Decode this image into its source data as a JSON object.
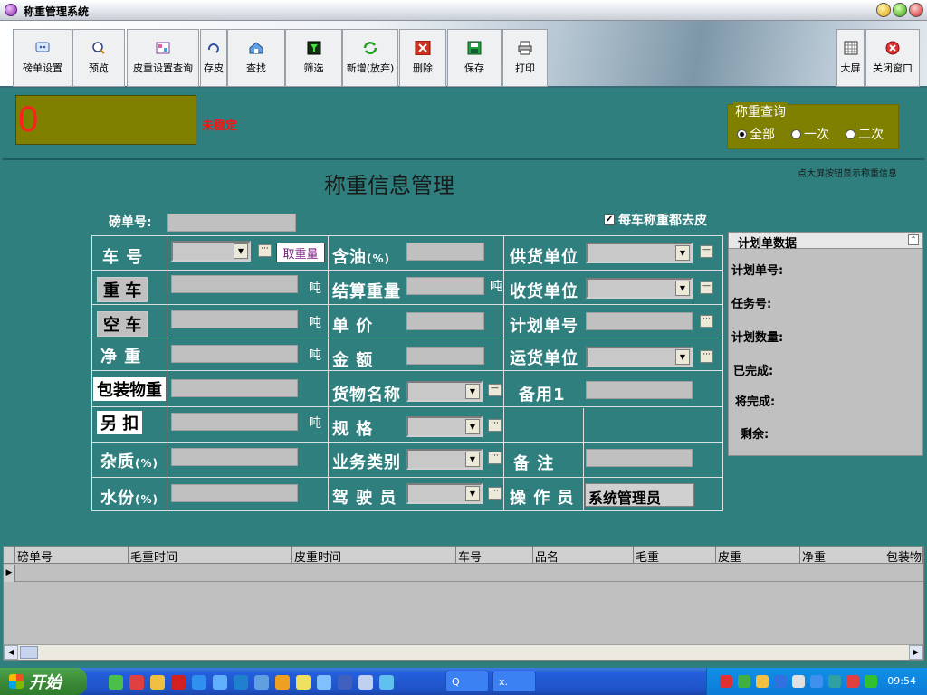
{
  "window": {
    "title": "称重管理系统"
  },
  "toolbar": {
    "items": [
      {
        "label": "磅单设置"
      },
      {
        "label": "预览"
      },
      {
        "label": "皮重设置查询"
      },
      {
        "label": "存皮"
      },
      {
        "label": "查找"
      },
      {
        "label": "筛选"
      },
      {
        "label": "新增(放弃)"
      },
      {
        "label": "删除"
      },
      {
        "label": "保存"
      },
      {
        "label": "打印"
      }
    ],
    "right": [
      {
        "label": "大屏"
      },
      {
        "label": "关闭窗口"
      }
    ]
  },
  "status": {
    "weight": "0",
    "stability": "未稳定",
    "query": {
      "legend": "称重查询",
      "options": [
        "全部",
        "一次",
        "二次"
      ],
      "selected": "全部"
    }
  },
  "form": {
    "title": "称重信息管理",
    "hint": "点大屏按钮显示称重信息",
    "bd_label": "磅单号:",
    "tare_checkbox": "每车称重都去皮",
    "tare_checked": true,
    "take_weight": "取重量",
    "unit": "吨",
    "percent": "(%)",
    "col1": {
      "plate": "车  号",
      "heavy": "重 车",
      "empty": "空 车",
      "net": "净  重",
      "package": "包装物重",
      "deduct": "另 扣",
      "impurity": "杂质",
      "moisture": "水份"
    },
    "col2": {
      "oil": "含油",
      "settle": "结算重量",
      "price": "单   价",
      "amount": "金   额",
      "goods": "货物名称",
      "spec": "规   格",
      "biz": "业务类别",
      "driver": "驾 驶 员"
    },
    "col3": {
      "supplier": "供货单位",
      "receiver": "收货单位",
      "plan_no": "计划单号",
      "carrier": "运货单位",
      "spare1": "备用1",
      "remark": "备   注",
      "operator": "操 作 员",
      "operator_value": "系统管理员"
    }
  },
  "plan": {
    "title": "计划单数据",
    "items": [
      "计划单号:",
      "任务号:",
      "计划数量:",
      "已完成:",
      "将完成:",
      "剩余:"
    ]
  },
  "grid": {
    "columns": [
      "磅单号",
      "毛重时间",
      "皮重时间",
      "车号",
      "品名",
      "毛重",
      "皮重",
      "净重",
      "包装物"
    ]
  },
  "taskbar": {
    "start": "开始",
    "tasks": [
      "Q",
      "x."
    ],
    "clock": "09:54"
  }
}
